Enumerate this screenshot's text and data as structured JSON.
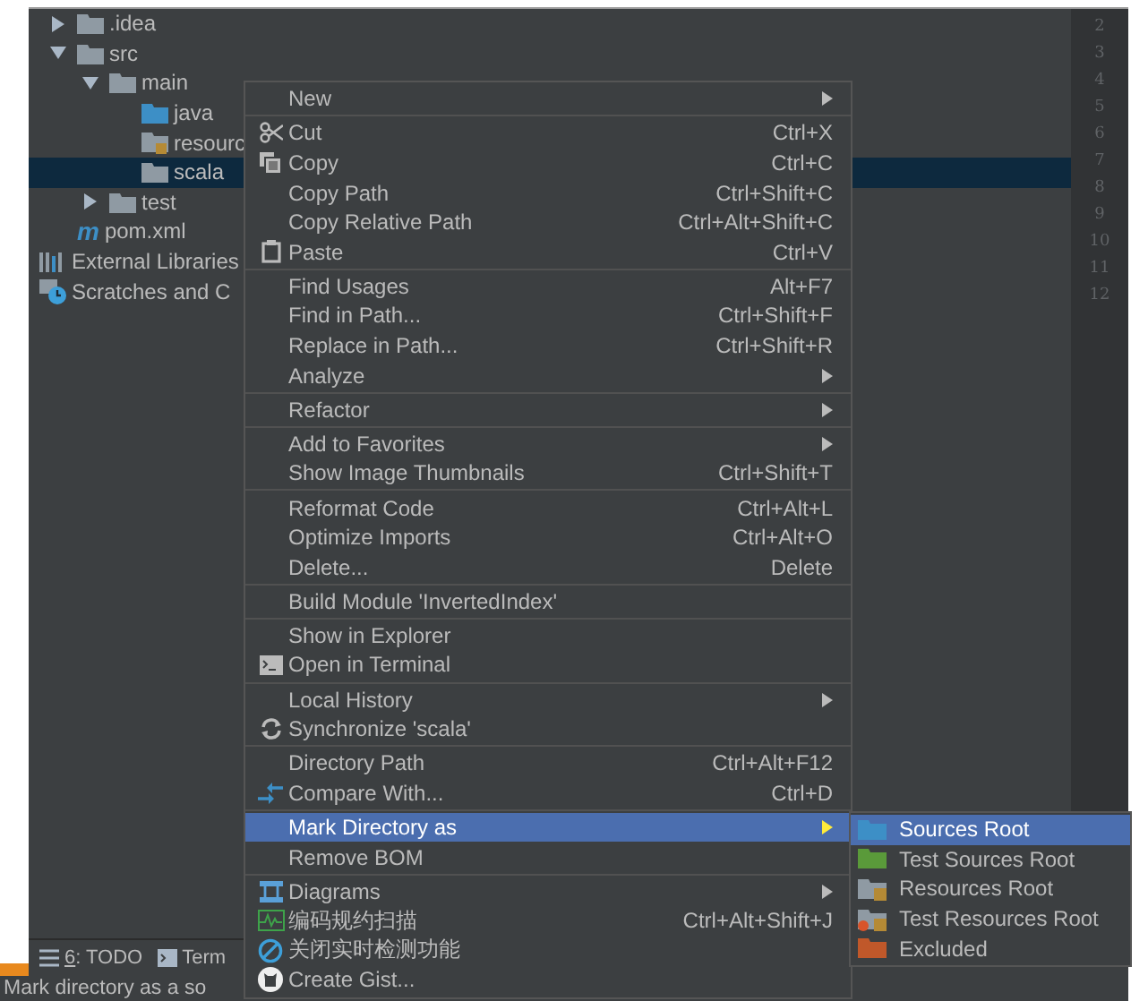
{
  "project_tree": {
    "items": [
      {
        "label": ".idea",
        "kind": "folder",
        "expanded": false,
        "selected": false
      },
      {
        "label": "src",
        "kind": "folder",
        "expanded": true,
        "selected": false,
        "children": [
          {
            "label": "main",
            "kind": "folder",
            "expanded": true,
            "selected": false,
            "children": [
              {
                "label": "java",
                "kind": "source-folder",
                "selected": false
              },
              {
                "label": "resourc",
                "kind": "resource-folder",
                "selected": false
              },
              {
                "label": "scala",
                "kind": "folder",
                "selected": true
              }
            ]
          },
          {
            "label": "test",
            "kind": "folder",
            "expanded": false,
            "selected": false
          }
        ]
      },
      {
        "label": "pom.xml",
        "kind": "maven",
        "badge": "m",
        "selected": false
      }
    ],
    "libraries": [
      {
        "label": "External Libraries",
        "kind": "libraries",
        "selected": false
      },
      {
        "label": "Scratches and C",
        "kind": "scratches",
        "selected": false
      }
    ]
  },
  "line_numbers": [
    "2",
    "3",
    "4",
    "5",
    "6",
    "7",
    "8",
    "9",
    "10",
    "11",
    "12"
  ],
  "context_menu": [
    [
      {
        "label": "New",
        "submenu": true,
        "selected": false
      }
    ],
    [
      {
        "label": "Cut",
        "shortcut": "Ctrl+X",
        "kind": "scissors",
        "selected": false
      },
      {
        "label": "Copy",
        "shortcut": "Ctrl+C",
        "kind": "copy",
        "selected": false
      },
      {
        "label": "Copy Path",
        "shortcut": "Ctrl+Shift+C",
        "selected": false
      },
      {
        "label": "Copy Relative Path",
        "shortcut": "Ctrl+Alt+Shift+C",
        "selected": false
      },
      {
        "label": "Paste",
        "shortcut": "Ctrl+V",
        "kind": "clipboard",
        "selected": false
      }
    ],
    [
      {
        "label": "Find Usages",
        "shortcut": "Alt+F7",
        "selected": false
      },
      {
        "label": "Find in Path...",
        "shortcut": "Ctrl+Shift+F",
        "selected": false
      },
      {
        "label": "Replace in Path...",
        "shortcut": "Ctrl+Shift+R",
        "selected": false
      },
      {
        "label": "Analyze",
        "submenu": true,
        "selected": false
      }
    ],
    [
      {
        "label": "Refactor",
        "submenu": true,
        "selected": false
      }
    ],
    [
      {
        "label": "Add to Favorites",
        "submenu": true,
        "selected": false
      },
      {
        "label": "Show Image Thumbnails",
        "shortcut": "Ctrl+Shift+T",
        "selected": false
      }
    ],
    [
      {
        "label": "Reformat Code",
        "shortcut": "Ctrl+Alt+L",
        "selected": false
      },
      {
        "label": "Optimize Imports",
        "shortcut": "Ctrl+Alt+O",
        "selected": false
      },
      {
        "label": "Delete...",
        "shortcut": "Delete",
        "selected": false
      }
    ],
    [
      {
        "label": "Build Module 'InvertedIndex'",
        "selected": false
      }
    ],
    [
      {
        "label": "Show in Explorer",
        "selected": false
      },
      {
        "label": "Open in Terminal",
        "kind": "terminal",
        "selected": false
      }
    ],
    [
      {
        "label": "Local History",
        "submenu": true,
        "selected": false
      },
      {
        "label": "Synchronize 'scala'",
        "kind": "sync",
        "selected": false
      }
    ],
    [
      {
        "label": "Directory Path",
        "shortcut": "Ctrl+Alt+F12",
        "selected": false
      },
      {
        "label": "Compare With...",
        "shortcut": "Ctrl+D",
        "kind": "compare",
        "selected": false
      }
    ],
    [
      {
        "label": "Mark Directory as",
        "submenu": true,
        "selected": true
      },
      {
        "label": "Remove BOM",
        "selected": false
      }
    ],
    [
      {
        "label": "Diagrams",
        "submenu": true,
        "kind": "diagram",
        "selected": false
      },
      {
        "label": "编码规约扫描",
        "shortcut": "Ctrl+Alt+Shift+J",
        "kind": "pulse",
        "selected": false
      },
      {
        "label": "关闭实时检测功能",
        "kind": "prohibit",
        "selected": false
      },
      {
        "label": "Create Gist...",
        "kind": "cat",
        "selected": false
      }
    ]
  ],
  "submenu": [
    {
      "label": "Sources Root",
      "color": "#3d8fc6",
      "kind": "folder",
      "selected": true
    },
    {
      "label": "Test Sources Root",
      "color": "#5a9a3a",
      "kind": "folder",
      "selected": false
    },
    {
      "label": "Resources Root",
      "color": "#8f9aa3",
      "kind": "resource-folder",
      "selected": false
    },
    {
      "label": "Test Resources Root",
      "color": "#8f9aa3",
      "kind": "test-resource-folder",
      "selected": false
    },
    {
      "label": "Excluded",
      "color": "#c0582a",
      "kind": "folder",
      "selected": false
    }
  ],
  "tool_windows": [
    {
      "number": "6",
      "label": ": TODO",
      "kind": "list"
    },
    {
      "label": "Term",
      "kind": "terminal"
    }
  ],
  "status_bar": "Mark directory as a so"
}
